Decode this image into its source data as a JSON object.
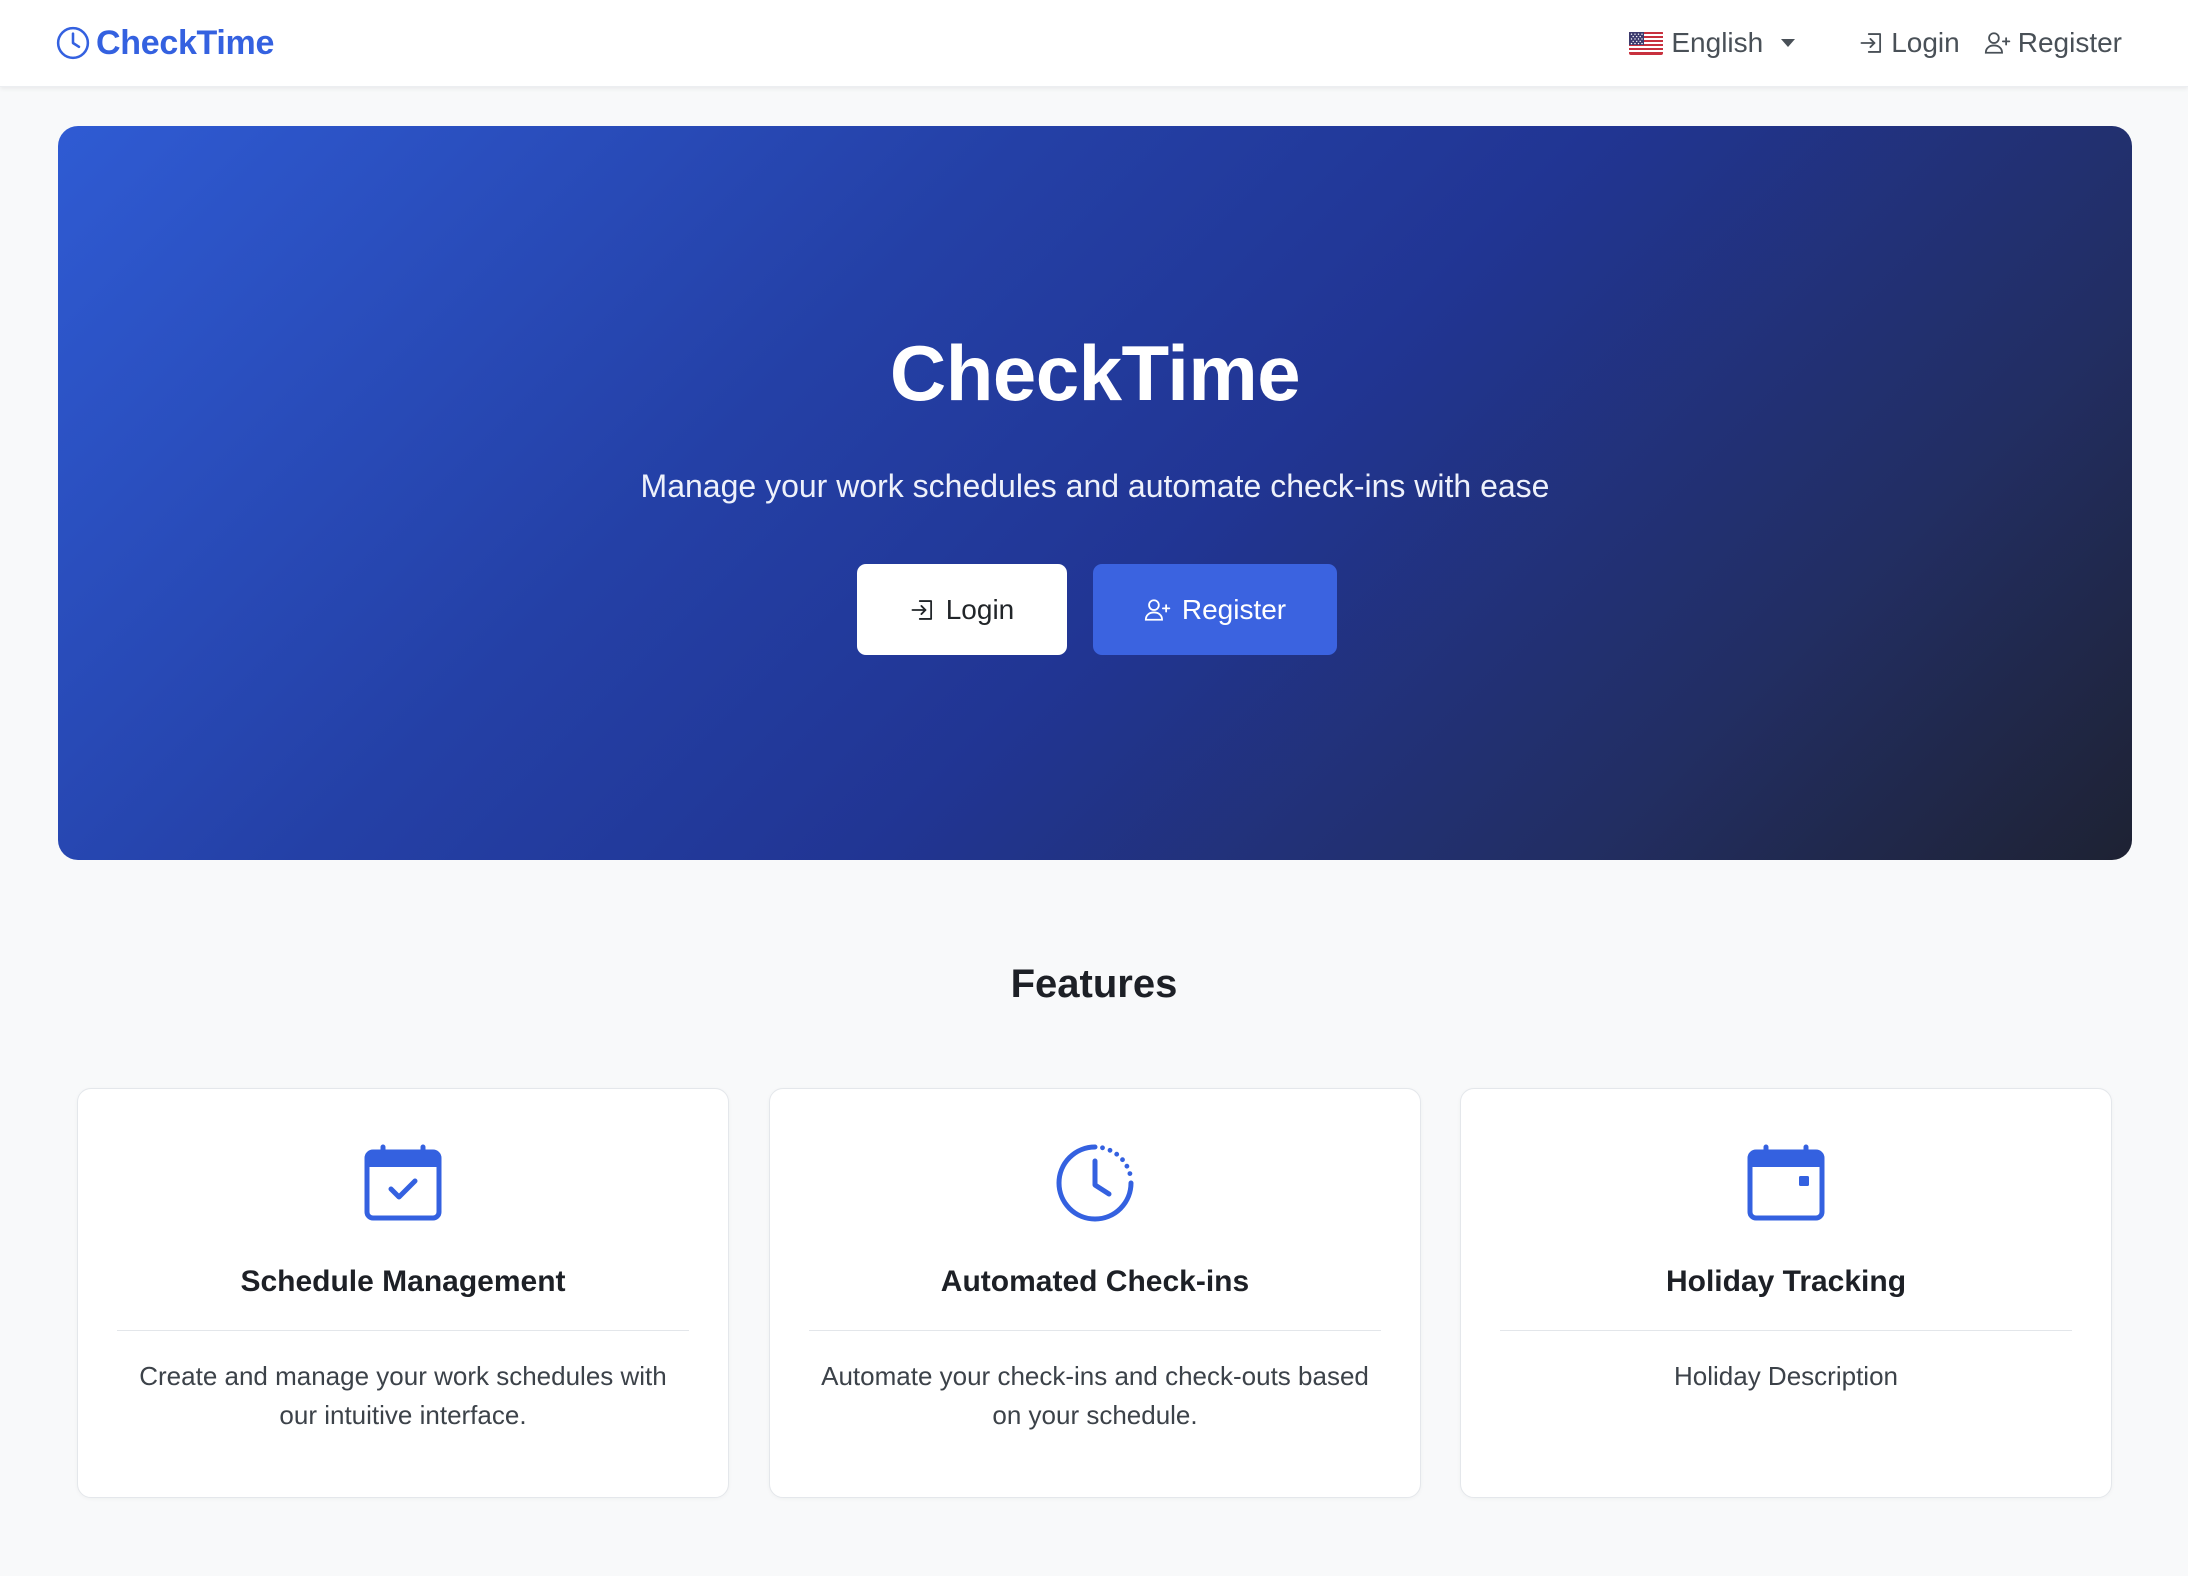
{
  "navbar": {
    "brand": "CheckTime",
    "brand_icon": "clock-icon",
    "language": {
      "label": "English",
      "flag": "us-flag-icon"
    },
    "login_label": "Login",
    "register_label": "Register"
  },
  "hero": {
    "title": "CheckTime",
    "subtitle": "Manage your work schedules and automate check-ins with ease",
    "login_button": "Login",
    "register_button": "Register"
  },
  "features": {
    "title": "Features",
    "items": [
      {
        "icon": "calendar-check-icon",
        "title": "Schedule Management",
        "description": "Create and manage your work schedules with our intuitive interface."
      },
      {
        "icon": "clock-history-icon",
        "title": "Automated Check-ins",
        "description": "Automate your check-ins and check-outs based on your schedule."
      },
      {
        "icon": "calendar-event-icon",
        "title": "Holiday Tracking",
        "description": "Holiday Description"
      }
    ]
  },
  "colors": {
    "primary": "#3b63e0",
    "hero_gradient_start": "#2f5bd3",
    "hero_gradient_end": "#1e2233",
    "background": "#f8f9fa"
  }
}
